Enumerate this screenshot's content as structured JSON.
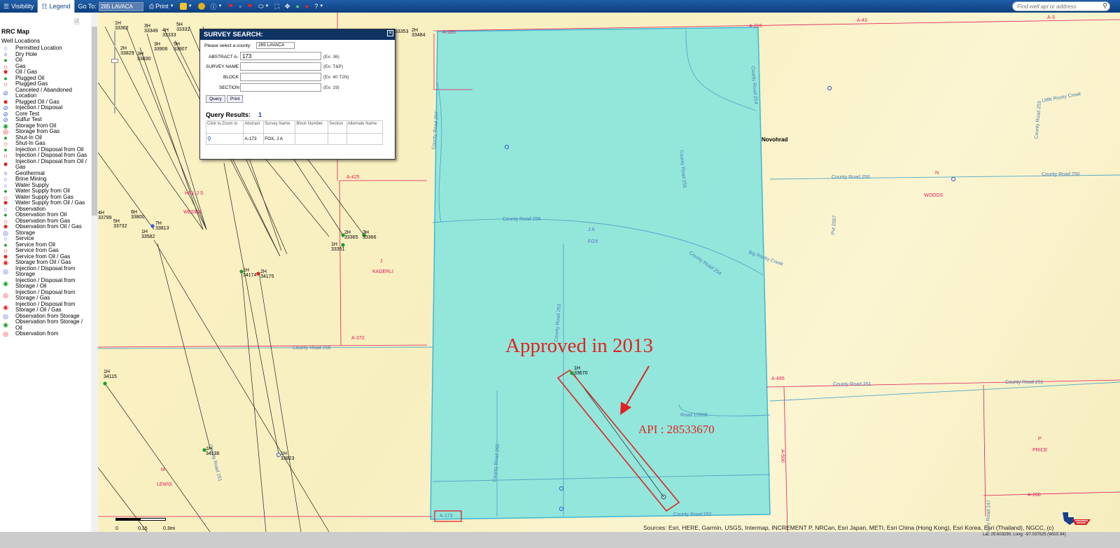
{
  "toolbar": {
    "visibility_label": "Visibility",
    "legend_label": "Legend",
    "goto_label": "Go To:",
    "goto_value": "285 LAVACA",
    "print_label": "Print",
    "search_placeholder": "Find well api or address"
  },
  "legend": {
    "title": "RRC Map",
    "subtitle": "Well Locations",
    "items": [
      {
        "label": "Permitted Location",
        "symbol": "○",
        "color": "#3b5bd6"
      },
      {
        "label": "Dry Hole",
        "symbol": "✧",
        "color": "#3b5bd6"
      },
      {
        "label": "Oil",
        "symbol": "●",
        "color": "#1a9e2a"
      },
      {
        "label": "Gas",
        "symbol": "☼",
        "color": "#e02020"
      },
      {
        "label": "Oil / Gas",
        "symbol": "✹",
        "color": "#e02020"
      },
      {
        "label": "Plugged Oil",
        "symbol": "●",
        "color": "#1a9e2a"
      },
      {
        "label": "Plugged Gas",
        "symbol": "☼",
        "color": "#e02020"
      },
      {
        "label": "Canceled / Abandoned Location",
        "symbol": "⊘",
        "color": "#3b5bd6"
      },
      {
        "label": "Plugged Oil / Gas",
        "symbol": "✹",
        "color": "#e02020"
      },
      {
        "label": "Injection / Disposal",
        "symbol": "⊘",
        "color": "#3b5bd6"
      },
      {
        "label": "Core Test",
        "symbol": "⊘",
        "color": "#3b5bd6"
      },
      {
        "label": "Sulfur Test",
        "symbol": "⊘",
        "color": "#3b5bd6"
      },
      {
        "label": "Storage from Oil",
        "symbol": "◉",
        "color": "#1a9e2a"
      },
      {
        "label": "Storage from Gas",
        "symbol": "◎",
        "color": "#e02020"
      },
      {
        "label": "Shut-In Oil",
        "symbol": "●",
        "color": "#1a9e2a"
      },
      {
        "label": "Shut-In Gas",
        "symbol": "☼",
        "color": "#e02020"
      },
      {
        "label": "Injection / Disposal from Oil",
        "symbol": "●",
        "color": "#1a9e2a"
      },
      {
        "label": "Injection / Disposal from Gas",
        "symbol": "☼",
        "color": "#e02020"
      },
      {
        "label": "Injection / Disposal from Oil / Gas",
        "symbol": "✹",
        "color": "#e02020"
      },
      {
        "label": "Geothermal",
        "symbol": "✧",
        "color": "#3b5bd6"
      },
      {
        "label": "Brine Mining",
        "symbol": "○",
        "color": "#3b5bd6"
      },
      {
        "label": "Water Supply",
        "symbol": "○",
        "color": "#3b5bd6"
      },
      {
        "label": "Water Supply from Oil",
        "symbol": "●",
        "color": "#1a9e2a"
      },
      {
        "label": "Water Supply from Gas",
        "symbol": "☼",
        "color": "#e02020"
      },
      {
        "label": "Water Supply from Oil / Gas",
        "symbol": "✹",
        "color": "#e02020"
      },
      {
        "label": "Observation",
        "symbol": "○",
        "color": "#3b5bd6"
      },
      {
        "label": "Observation from Oil",
        "symbol": "●",
        "color": "#1a9e2a"
      },
      {
        "label": "Observation from Gas",
        "symbol": "☼",
        "color": "#e02020"
      },
      {
        "label": "Observation from Oil / Gas",
        "symbol": "✹",
        "color": "#e02020"
      },
      {
        "label": "Storage",
        "symbol": "◎",
        "color": "#3b5bd6"
      },
      {
        "label": "Service",
        "symbol": "○",
        "color": "#3b5bd6"
      },
      {
        "label": "Service from Oil",
        "symbol": "●",
        "color": "#1a9e2a"
      },
      {
        "label": "Service from Gas",
        "symbol": "☼",
        "color": "#e02020"
      },
      {
        "label": "Service from Oil / Gas",
        "symbol": "✹",
        "color": "#e02020"
      },
      {
        "label": "Storage from Oil / Gas",
        "symbol": "◉",
        "color": "#e02020"
      },
      {
        "label": "Injection / Disposal from Storage",
        "symbol": "◎",
        "color": "#3b5bd6"
      },
      {
        "label": "Injection / Disposal from Storage / Oil",
        "symbol": "◉",
        "color": "#1a9e2a"
      },
      {
        "label": "Injection / Disposal from Storage / Gas",
        "symbol": "◎",
        "color": "#e02020"
      },
      {
        "label": "Injection / Disposal from Storage / Oil / Gas",
        "symbol": "◉",
        "color": "#e02020"
      },
      {
        "label": "Observation from Storage",
        "symbol": "◎",
        "color": "#3b5bd6"
      },
      {
        "label": "Observation from Storage / Oil",
        "symbol": "◉",
        "color": "#1a9e2a"
      },
      {
        "label": "Observation from",
        "symbol": "◎",
        "color": "#e02020"
      }
    ]
  },
  "survey_dialog": {
    "title": "SURVEY SEARCH:",
    "county_prompt": "Please select a county:",
    "county_value": "285 LAVACA",
    "fields": [
      {
        "label": "ABSTRACT A-",
        "value": "173",
        "hint": "(Ex: 36)"
      },
      {
        "label": "SURVEY NAME",
        "value": "",
        "hint": "(Ex: T&P)"
      },
      {
        "label": "BLOCK",
        "value": "",
        "hint": "(Ex: 40 T2N)"
      },
      {
        "label": "SECTION",
        "value": "",
        "hint": "(Ex: 19)"
      }
    ],
    "query_button": "Query",
    "print_button": "Print",
    "results_title": "Query Results:",
    "results_count": "1",
    "columns": [
      "Click to Zoom to",
      "Abstract",
      "Survey Name",
      "Block Number",
      "Section",
      "Alternate Name"
    ],
    "rows": [
      {
        "abstract": "A-173",
        "survey_name": "FOX, J A",
        "block": "",
        "section": "",
        "alternate": ""
      }
    ]
  },
  "annotation": {
    "title": "Approved in 2013",
    "api": "API : 28533670"
  },
  "map": {
    "abstract_label": "A-173",
    "place_label": "Novohrad",
    "survey_labels": [
      "J A",
      "FOX",
      "J",
      "KADERLI",
      "WOODS",
      "P",
      "PRICE",
      "M",
      "LEWIS",
      "N",
      "HILL J S",
      "WEDER"
    ],
    "road_labels": [
      "County Road 256",
      "County Road 256",
      "County Road 257",
      "County Road 250",
      "County Road 250",
      "County Road 251",
      "County Road 251",
      "County Road 252",
      "County Road 262",
      "County Road 263",
      "County Road 261",
      "County Road 253",
      "County Road 255",
      "County Road 254",
      "Road 1295B",
      "Big Rocky Creek",
      "Little Rocky Creek",
      "Pvt 2007",
      "County Road 254",
      "County Road 247"
    ],
    "abstract_labels": [
      "A-185",
      "A-425",
      "A-372",
      "A-495",
      "A-506",
      "A-43",
      "A-215",
      "A-260",
      "A-3"
    ],
    "scale": {
      "zero": "0",
      "mid": "0.15",
      "end": "0.3mi"
    },
    "wells": [
      {
        "id": "1H",
        "num": "33670"
      },
      {
        "id": "1H",
        "num": "34115"
      },
      {
        "id": "1H",
        "num": "34136"
      },
      {
        "id": "1H",
        "num": "33823"
      },
      {
        "id": "1H",
        "num": "34174"
      },
      {
        "id": "2H",
        "num": "34175"
      },
      {
        "id": "2H",
        "num": "33365"
      },
      {
        "id": "3H",
        "num": "33366"
      },
      {
        "id": "1H",
        "num": "33351"
      },
      {
        "id": "7H",
        "num": "33813"
      },
      {
        "id": "1H",
        "num": "33582"
      },
      {
        "id": "6H",
        "num": "33800"
      },
      {
        "id": "5H",
        "num": "33732"
      },
      {
        "id": "4H",
        "num": "33799"
      }
    ],
    "top_wells": [
      "1H",
      "33362",
      "3H",
      "33349",
      "4H",
      "33333",
      "5H",
      "33332",
      "2H",
      "33829",
      "3H",
      "33830",
      "3H",
      "33906",
      "5H",
      "33907",
      "33353",
      "2H",
      "33484"
    ]
  },
  "attribution": "Sources: Esri, HERE, Garmin, USGS, Intermap, INCREMENT P, NRCan, Esri Japan, METI, Esri China (Hong Kong), Esri Korea, Esri (Thailand), NGCC, (c)",
  "coordinates": "Lat: 29.603290, Long: -97.037525 (WGS 84)"
}
